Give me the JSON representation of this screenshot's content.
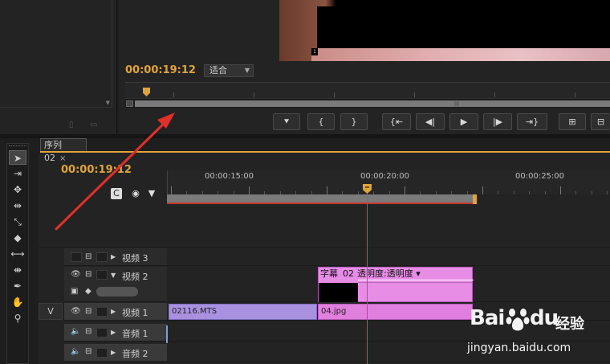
{
  "monitor": {
    "timecode": "00:00:19:12",
    "fit_label": "适合",
    "frame_number": "1",
    "transport": [
      "⯆",
      "{",
      "}",
      "{⇤",
      "◀|",
      "▶",
      "|▶",
      "⇥}",
      "⊞",
      "⊟"
    ]
  },
  "timeline": {
    "tab_label": "序列 02",
    "tab_close": "×",
    "timecode": "00:00:19:12",
    "ruler_labels": [
      "00:00:15:00",
      "00:00:20:00",
      "00:00:25:00"
    ],
    "tracks": [
      {
        "label": "视频 3"
      },
      {
        "label": "视频 2"
      },
      {
        "label": "视频 1",
        "target": "V"
      },
      {
        "label": "音频 1"
      },
      {
        "label": "音频 2"
      }
    ],
    "clips": {
      "mts": "02116.MTS",
      "jpg": "04.jpg",
      "subtitle_name": "字幕",
      "subtitle_num": "02",
      "subtitle_fx": "透明度:透明度 ▾"
    }
  },
  "watermark": {
    "brand_a": "Bai",
    "brand_b": "du",
    "brand_cn": "经验",
    "url": "jingyan.baidu.com"
  },
  "colors": {
    "timecode": "#e0a43b",
    "playhead": "#d34b3d",
    "clip_video": "#a991e0",
    "clip_image": "#e17fdf",
    "annotation": "#e0302a"
  }
}
